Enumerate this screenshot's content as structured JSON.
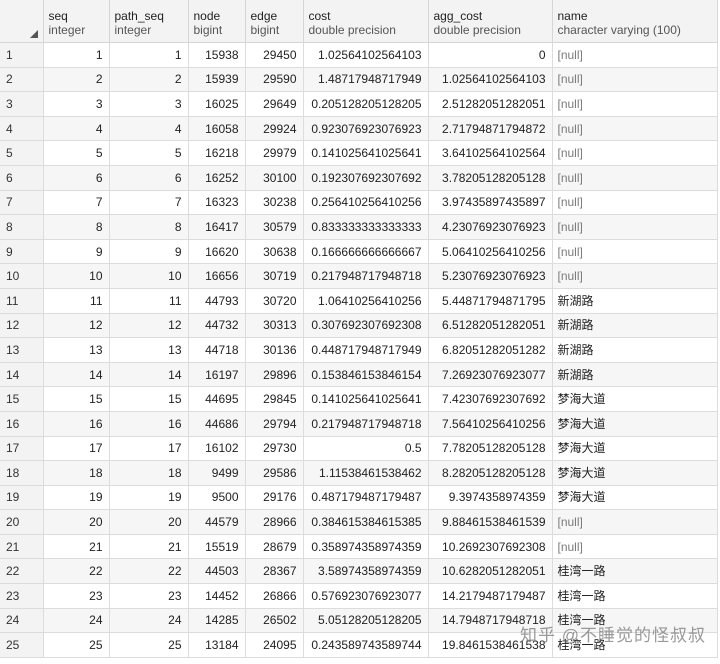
{
  "columns": [
    {
      "name": "seq",
      "type": "integer"
    },
    {
      "name": "path_seq",
      "type": "integer"
    },
    {
      "name": "node",
      "type": "bigint"
    },
    {
      "name": "edge",
      "type": "bigint"
    },
    {
      "name": "cost",
      "type": "double precision"
    },
    {
      "name": "agg_cost",
      "type": "double precision"
    },
    {
      "name": "name",
      "type": "character varying (100)"
    }
  ],
  "rows": [
    {
      "idx": "1",
      "seq": "1",
      "path_seq": "1",
      "node": "15938",
      "edge": "29450",
      "cost": "1.02564102564103",
      "agg_cost": "0",
      "name": "[null]"
    },
    {
      "idx": "2",
      "seq": "2",
      "path_seq": "2",
      "node": "15939",
      "edge": "29590",
      "cost": "1.48717948717949",
      "agg_cost": "1.02564102564103",
      "name": "[null]"
    },
    {
      "idx": "3",
      "seq": "3",
      "path_seq": "3",
      "node": "16025",
      "edge": "29649",
      "cost": "0.205128205128205",
      "agg_cost": "2.51282051282051",
      "name": "[null]"
    },
    {
      "idx": "4",
      "seq": "4",
      "path_seq": "4",
      "node": "16058",
      "edge": "29924",
      "cost": "0.923076923076923",
      "agg_cost": "2.71794871794872",
      "name": "[null]"
    },
    {
      "idx": "5",
      "seq": "5",
      "path_seq": "5",
      "node": "16218",
      "edge": "29979",
      "cost": "0.141025641025641",
      "agg_cost": "3.64102564102564",
      "name": "[null]"
    },
    {
      "idx": "6",
      "seq": "6",
      "path_seq": "6",
      "node": "16252",
      "edge": "30100",
      "cost": "0.192307692307692",
      "agg_cost": "3.78205128205128",
      "name": "[null]"
    },
    {
      "idx": "7",
      "seq": "7",
      "path_seq": "7",
      "node": "16323",
      "edge": "30238",
      "cost": "0.256410256410256",
      "agg_cost": "3.97435897435897",
      "name": "[null]"
    },
    {
      "idx": "8",
      "seq": "8",
      "path_seq": "8",
      "node": "16417",
      "edge": "30579",
      "cost": "0.833333333333333",
      "agg_cost": "4.23076923076923",
      "name": "[null]"
    },
    {
      "idx": "9",
      "seq": "9",
      "path_seq": "9",
      "node": "16620",
      "edge": "30638",
      "cost": "0.166666666666667",
      "agg_cost": "5.06410256410256",
      "name": "[null]"
    },
    {
      "idx": "10",
      "seq": "10",
      "path_seq": "10",
      "node": "16656",
      "edge": "30719",
      "cost": "0.217948717948718",
      "agg_cost": "5.23076923076923",
      "name": "[null]"
    },
    {
      "idx": "11",
      "seq": "11",
      "path_seq": "11",
      "node": "44793",
      "edge": "30720",
      "cost": "1.06410256410256",
      "agg_cost": "5.44871794871795",
      "name": "新湖路"
    },
    {
      "idx": "12",
      "seq": "12",
      "path_seq": "12",
      "node": "44732",
      "edge": "30313",
      "cost": "0.307692307692308",
      "agg_cost": "6.51282051282051",
      "name": "新湖路"
    },
    {
      "idx": "13",
      "seq": "13",
      "path_seq": "13",
      "node": "44718",
      "edge": "30136",
      "cost": "0.448717948717949",
      "agg_cost": "6.82051282051282",
      "name": "新湖路"
    },
    {
      "idx": "14",
      "seq": "14",
      "path_seq": "14",
      "node": "16197",
      "edge": "29896",
      "cost": "0.153846153846154",
      "agg_cost": "7.26923076923077",
      "name": "新湖路"
    },
    {
      "idx": "15",
      "seq": "15",
      "path_seq": "15",
      "node": "44695",
      "edge": "29845",
      "cost": "0.141025641025641",
      "agg_cost": "7.42307692307692",
      "name": "梦海大道"
    },
    {
      "idx": "16",
      "seq": "16",
      "path_seq": "16",
      "node": "44686",
      "edge": "29794",
      "cost": "0.217948717948718",
      "agg_cost": "7.56410256410256",
      "name": "梦海大道"
    },
    {
      "idx": "17",
      "seq": "17",
      "path_seq": "17",
      "node": "16102",
      "edge": "29730",
      "cost": "0.5",
      "agg_cost": "7.78205128205128",
      "name": "梦海大道"
    },
    {
      "idx": "18",
      "seq": "18",
      "path_seq": "18",
      "node": "9499",
      "edge": "29586",
      "cost": "1.11538461538462",
      "agg_cost": "8.28205128205128",
      "name": "梦海大道"
    },
    {
      "idx": "19",
      "seq": "19",
      "path_seq": "19",
      "node": "9500",
      "edge": "29176",
      "cost": "0.487179487179487",
      "agg_cost": "9.3974358974359",
      "name": "梦海大道"
    },
    {
      "idx": "20",
      "seq": "20",
      "path_seq": "20",
      "node": "44579",
      "edge": "28966",
      "cost": "0.384615384615385",
      "agg_cost": "9.88461538461539",
      "name": "[null]"
    },
    {
      "idx": "21",
      "seq": "21",
      "path_seq": "21",
      "node": "15519",
      "edge": "28679",
      "cost": "0.358974358974359",
      "agg_cost": "10.2692307692308",
      "name": "[null]"
    },
    {
      "idx": "22",
      "seq": "22",
      "path_seq": "22",
      "node": "44503",
      "edge": "28367",
      "cost": "3.58974358974359",
      "agg_cost": "10.6282051282051",
      "name": "桂湾一路"
    },
    {
      "idx": "23",
      "seq": "23",
      "path_seq": "23",
      "node": "14452",
      "edge": "26866",
      "cost": "0.576923076923077",
      "agg_cost": "14.2179487179487",
      "name": "桂湾一路"
    },
    {
      "idx": "24",
      "seq": "24",
      "path_seq": "24",
      "node": "14285",
      "edge": "26502",
      "cost": "5.05128205128205",
      "agg_cost": "14.7948717948718",
      "name": "桂湾一路"
    },
    {
      "idx": "25",
      "seq": "25",
      "path_seq": "25",
      "node": "13184",
      "edge": "24095",
      "cost": "0.243589743589744",
      "agg_cost": "19.8461538461538",
      "name": "桂湾一路"
    }
  ],
  "watermark": "知乎 @不睡觉的怪叔叔",
  "colors": {
    "header_bg": "#f3f3f3",
    "accent": "#3a7bd5",
    "null_text": "#7b7b7b"
  }
}
